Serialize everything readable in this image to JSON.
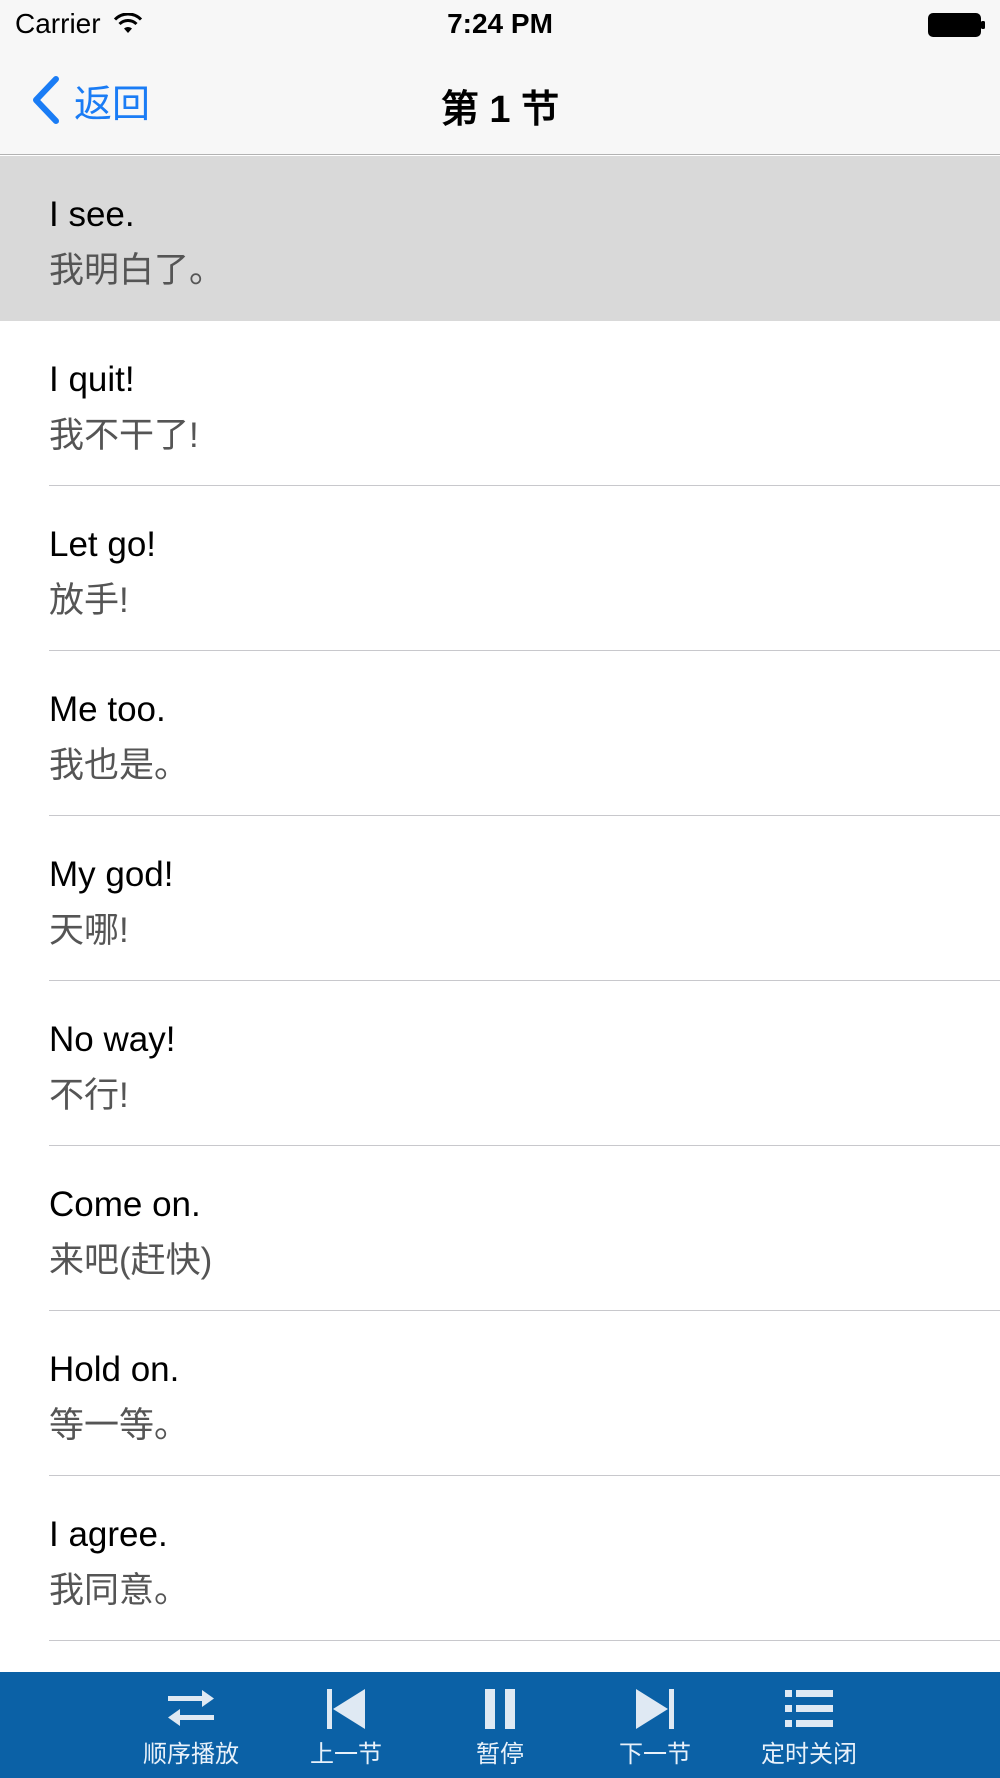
{
  "status": {
    "carrier": "Carrier",
    "time": "7:24 PM"
  },
  "nav": {
    "back_label": "返回",
    "title": "第 1 节"
  },
  "rows": [
    {
      "en": "I see.",
      "zh": "我明白了。",
      "selected": true
    },
    {
      "en": "I quit!",
      "zh": "我不干了!"
    },
    {
      "en": "Let go!",
      "zh": "放手!"
    },
    {
      "en": "Me too.",
      "zh": "我也是。"
    },
    {
      "en": "My god!",
      "zh": "天哪!"
    },
    {
      "en": "No way!",
      "zh": "不行!"
    },
    {
      "en": "Come on.",
      "zh": "来吧(赶快)"
    },
    {
      "en": "Hold on.",
      "zh": "等一等。"
    },
    {
      "en": "I agree.",
      "zh": "我同意。"
    }
  ],
  "toolbar": {
    "order_play": "顺序播放",
    "prev_section": "上一节",
    "pause": "暂停",
    "next_section": "下一节",
    "timer_close": "定时关闭"
  },
  "icons": {
    "wifi": "wifi-icon",
    "battery": "battery-icon",
    "back": "chevron-left-icon",
    "order": "shuffle-arrows-icon",
    "prev": "skip-back-icon",
    "pause": "pause-icon",
    "next": "skip-forward-icon",
    "timer": "list-icon"
  },
  "colors": {
    "accent": "#1a7cf5",
    "toolbar_bg": "#0b61a6",
    "selected_row": "#d9d9d9"
  }
}
